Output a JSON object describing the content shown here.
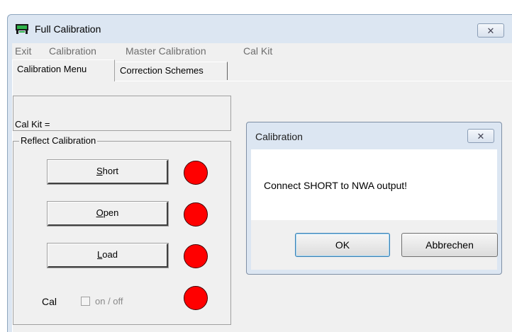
{
  "window": {
    "title": "Full Calibration",
    "close_glyph": "✕"
  },
  "menu": [
    "Exit",
    "Calibration",
    "Master Calibration",
    "Cal Kit"
  ],
  "tabs": [
    "Calibration Menu",
    "Correction Schemes"
  ],
  "calkit": {
    "label": "Cal Kit ="
  },
  "reflect": {
    "group_label": "Reflect Calibration",
    "short_label": "Short",
    "open_label": "Open",
    "load_label": "Load",
    "cal_label": "Cal",
    "toggle_label": "on / off",
    "toggle_checked": false
  },
  "dialog": {
    "title": "Calibration",
    "message": "Connect SHORT to NWA output!",
    "ok_label": "OK",
    "cancel_label": "Abbrechen",
    "close_glyph": "✕"
  },
  "colors": {
    "led": "#ff0000",
    "frame": "#dce6f2"
  }
}
